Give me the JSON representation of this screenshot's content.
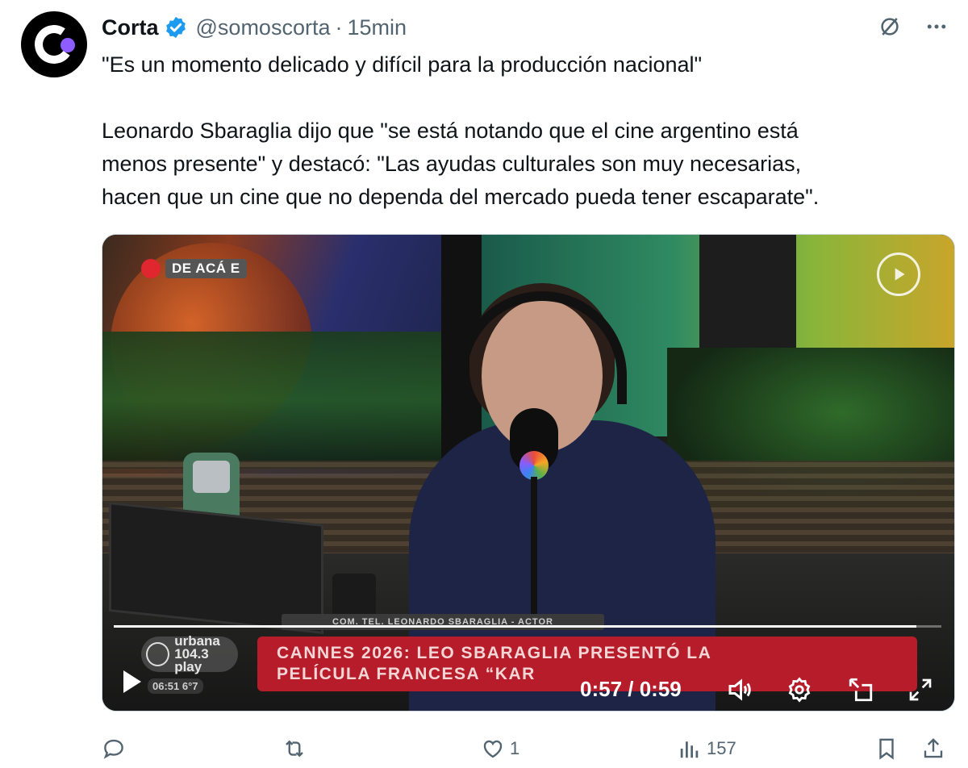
{
  "author": {
    "display_name": "Corta",
    "handle": "@somoscorta",
    "separator": "·",
    "timestamp": "15min",
    "verified": true
  },
  "tweet": {
    "paragraphs": [
      "\"Es un momento delicado y difícil para la producción nacional\"",
      "Leonardo Sbaraglia dijo que \"se está notando que el cine argentino está\nmenos presente\" y destacó: \"Las ayudas culturales son muy necesarias,\nhacen que un cine que no dependa del mercado pueda tener escaparate\"."
    ]
  },
  "video": {
    "live_tag": "DE ACÁ E",
    "lower_third_small": "COM. TEL. LEONARDO SBARAGLIA - ACTOR",
    "headline": "CANNES 2026: LEO SBARAGLIA PRESENTÓ LA\nPELÍCULA FRANCESA “KAR",
    "station_name": "urbana\n104.3 play",
    "station_clock": "06:51  6°7",
    "time_display": "0:57 / 0:59",
    "progress": 0.97
  },
  "actions": {
    "replies": "",
    "reposts": "",
    "likes": "1",
    "views": "157"
  },
  "icons": {
    "verified": "verified-badge-icon",
    "grok": "grok-icon",
    "more": "more-icon",
    "play": "play-icon",
    "volume": "volume-icon",
    "settings": "settings-icon",
    "pip": "picture-in-picture-icon",
    "fullscreen": "fullscreen-icon",
    "reply": "reply-icon",
    "repost": "repost-icon",
    "like": "like-icon",
    "views": "views-icon",
    "bookmark": "bookmark-icon",
    "share": "share-icon"
  },
  "colors": {
    "accent_blue": "#1d9bf0",
    "brand_purple": "#8e5cff",
    "banner_red": "#b71c2a",
    "text_secondary": "#536471"
  }
}
